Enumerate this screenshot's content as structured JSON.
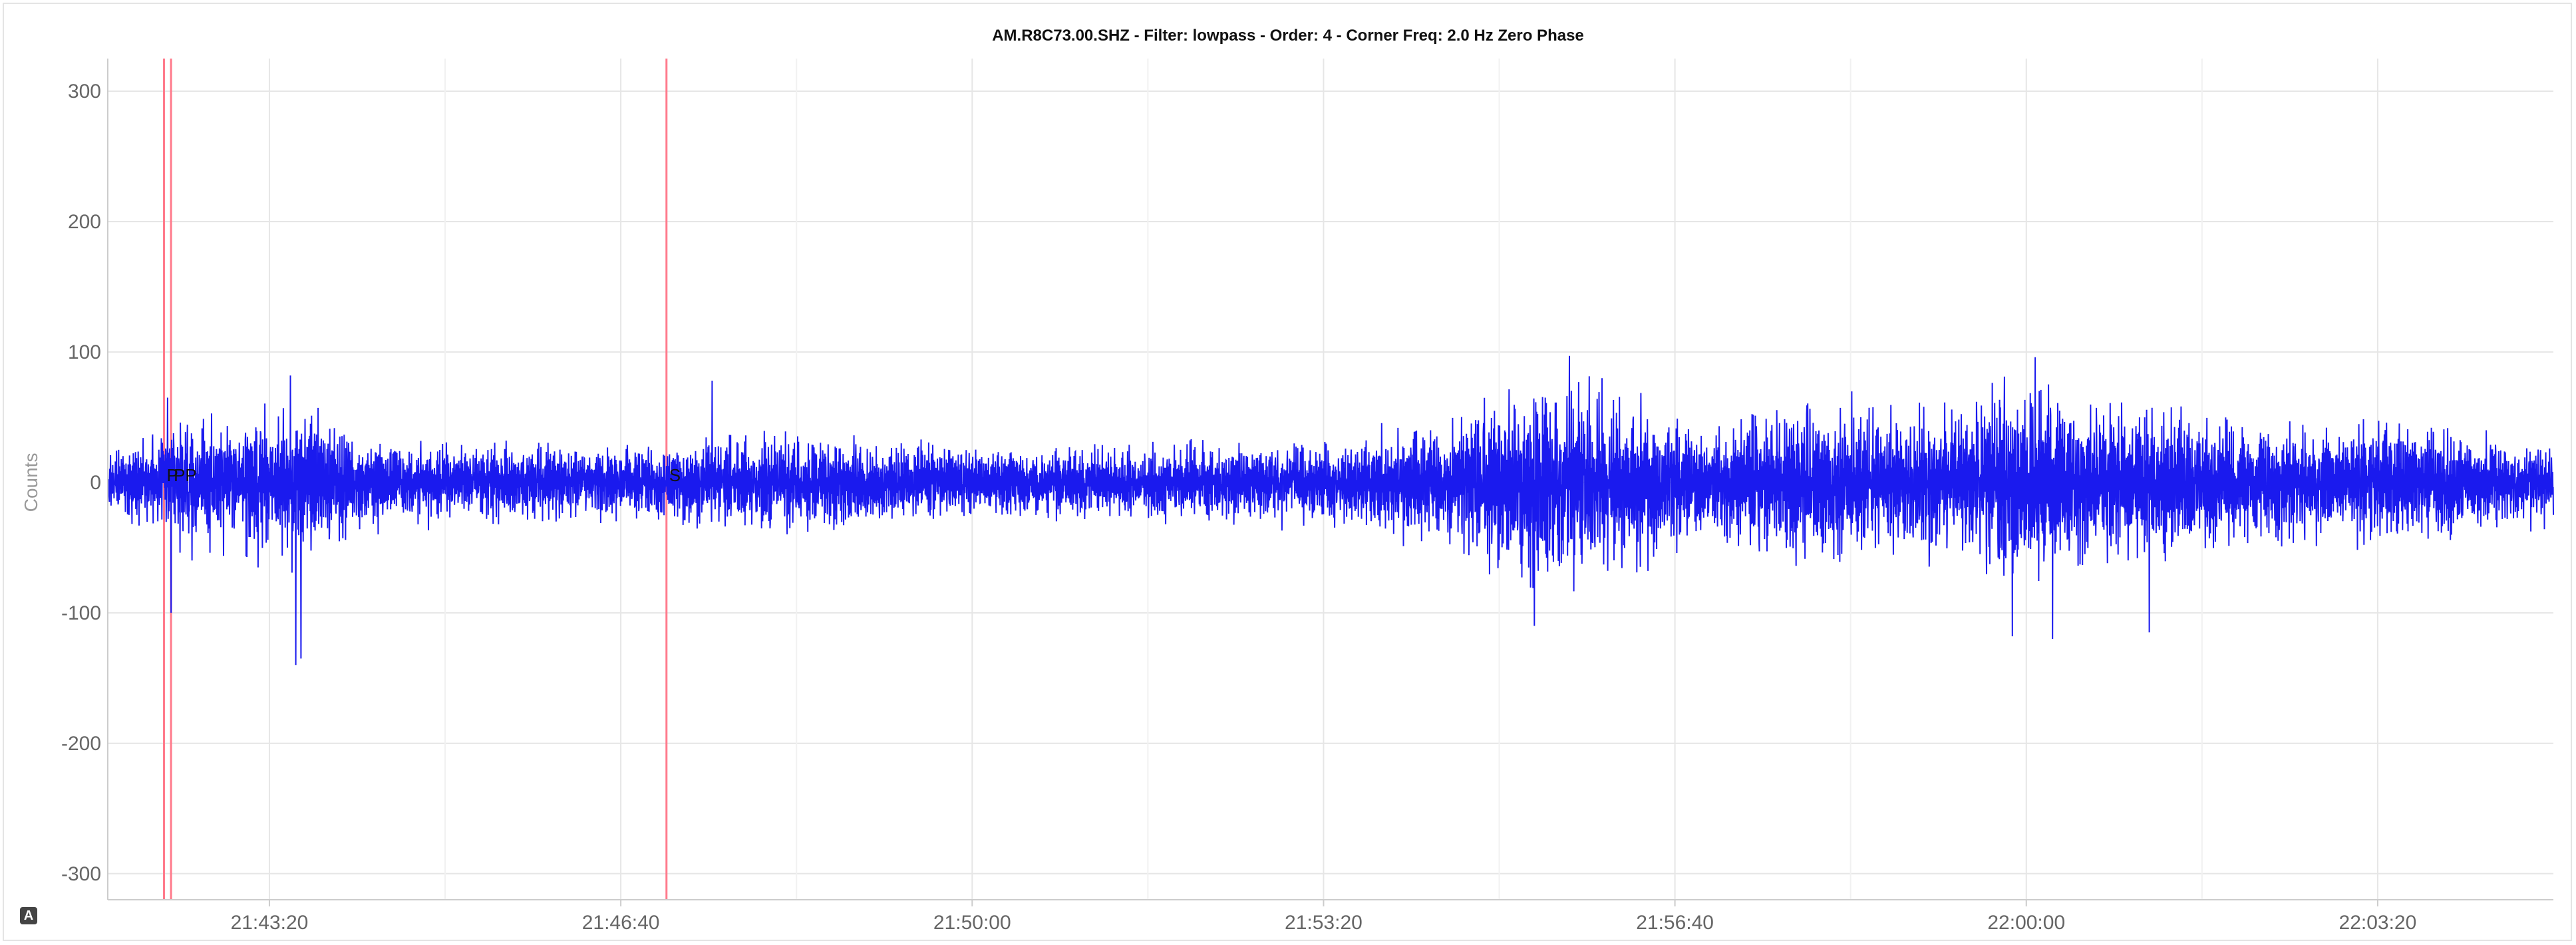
{
  "chart_data": {
    "type": "line",
    "title": "AM.R8C73.00.SHZ - Filter: lowpass - Order: 4 - Corner Freq: 2.0 Hz Zero Phase",
    "xlabel": "",
    "ylabel": "Counts",
    "x_range": [
      "21:41:48",
      "22:05:00"
    ],
    "ylim": [
      -320,
      325
    ],
    "y_ticks": [
      300,
      200,
      100,
      0,
      -100,
      -200,
      -300
    ],
    "x_ticks": [
      "21:43:20",
      "21:46:40",
      "21:50:00",
      "21:53:20",
      "21:56:40",
      "22:00:00",
      "22:03:20"
    ],
    "grid": true,
    "series": [
      {
        "color": "#1a1aee",
        "envelope": [
          {
            "t": "21:41:48",
            "amp": 22
          },
          {
            "t": "21:42:15",
            "amp": 30
          },
          {
            "t": "21:42:30",
            "amp": 45
          },
          {
            "t": "21:43:00",
            "amp": 40
          },
          {
            "t": "21:43:30",
            "amp": 60
          },
          {
            "t": "21:43:45",
            "amp": 45
          },
          {
            "t": "21:44:30",
            "amp": 28
          },
          {
            "t": "21:47:00",
            "amp": 25
          },
          {
            "t": "21:47:30",
            "amp": 35
          },
          {
            "t": "21:50:00",
            "amp": 25
          },
          {
            "t": "21:53:00",
            "amp": 28
          },
          {
            "t": "21:54:30",
            "amp": 40
          },
          {
            "t": "21:55:20",
            "amp": 70
          },
          {
            "t": "21:56:10",
            "amp": 60
          },
          {
            "t": "21:57:00",
            "amp": 38
          },
          {
            "t": "21:58:00",
            "amp": 55
          },
          {
            "t": "21:59:00",
            "amp": 50
          },
          {
            "t": "22:00:00",
            "amp": 70
          },
          {
            "t": "22:01:00",
            "amp": 55
          },
          {
            "t": "22:02:00",
            "amp": 42
          },
          {
            "t": "22:03:30",
            "amp": 40
          },
          {
            "t": "22:05:00",
            "amp": 28
          }
        ],
        "spikes": [
          {
            "t": "21:42:24",
            "v": -100
          },
          {
            "t": "21:42:22",
            "v": 65
          },
          {
            "t": "21:43:32",
            "v": 82
          },
          {
            "t": "21:43:35",
            "v": -140
          },
          {
            "t": "21:43:38",
            "v": -135
          },
          {
            "t": "21:47:32",
            "v": 78
          },
          {
            "t": "21:55:20",
            "v": -110
          },
          {
            "t": "21:55:40",
            "v": 97
          },
          {
            "t": "21:59:52",
            "v": -118
          },
          {
            "t": "22:00:05",
            "v": 96
          },
          {
            "t": "22:00:15",
            "v": -120
          },
          {
            "t": "22:01:10",
            "v": -115
          }
        ]
      }
    ],
    "phase_markers": [
      {
        "label": "P",
        "t": "21:42:20"
      },
      {
        "label": "PP",
        "t": "21:42:24"
      },
      {
        "label": "S",
        "t": "21:47:06"
      }
    ],
    "marker_color": "#ff7b8c"
  },
  "page": {
    "badge_text": "A"
  }
}
